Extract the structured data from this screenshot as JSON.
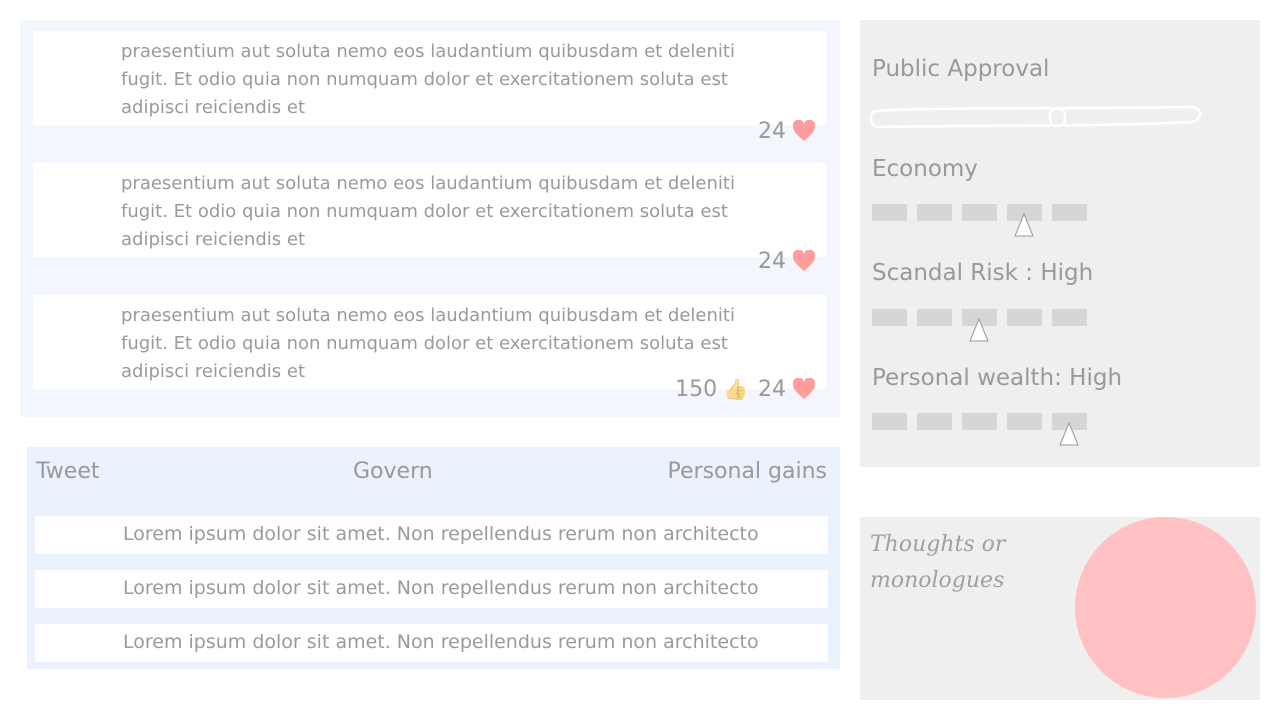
{
  "feed": {
    "posts": [
      {
        "text": "praesentium aut soluta nemo eos laudantium quibusdam et deleniti fugit. Et odio quia non numquam dolor et exercitationem soluta est adipisci reiciendis et",
        "likes": "",
        "hearts": "24"
      },
      {
        "text": "praesentium aut soluta nemo eos laudantium quibusdam et deleniti fugit. Et odio quia non numquam dolor et exercitationem soluta est adipisci reiciendis et",
        "likes": "",
        "hearts": "24"
      },
      {
        "text": "praesentium aut soluta nemo eos laudantium quibusdam et deleniti fugit. Et odio quia non numquam dolor et exercitationem soluta est adipisci reiciendis et",
        "likes": "150",
        "hearts": "24"
      }
    ]
  },
  "actions": {
    "tabs": [
      "Tweet",
      "Govern",
      "Personal gains"
    ],
    "options": [
      "Lorem ipsum dolor sit amet. Non repellendus rerum non architecto",
      "Lorem ipsum dolor sit amet. Non repellendus rerum non architecto",
      "Lorem ipsum dolor sit amet. Non repellendus rerum non architecto"
    ]
  },
  "stats": {
    "public_approval": {
      "label": "Public Approval",
      "level_fraction": 0.58
    },
    "economy": {
      "label": "Economy",
      "level": 4,
      "max": 5
    },
    "scandal_risk": {
      "label": "Scandal Risk : High",
      "level": 3,
      "max": 5
    },
    "personal_wealth": {
      "label": "Personal wealth: High",
      "level": 5,
      "max": 5
    }
  },
  "thoughts": {
    "text": "Thoughts or monologues"
  },
  "colors": {
    "heart": "#ff9c9c",
    "thoughts_circle": "#ffc1c1",
    "feed_bg": "#f3f6fd",
    "actions_bg": "#ebf1fd",
    "panel_bg": "#efefef"
  },
  "icons": {
    "heart": "heart-icon",
    "like": "thumbs-up-icon",
    "marker": "triangle-marker-icon"
  }
}
